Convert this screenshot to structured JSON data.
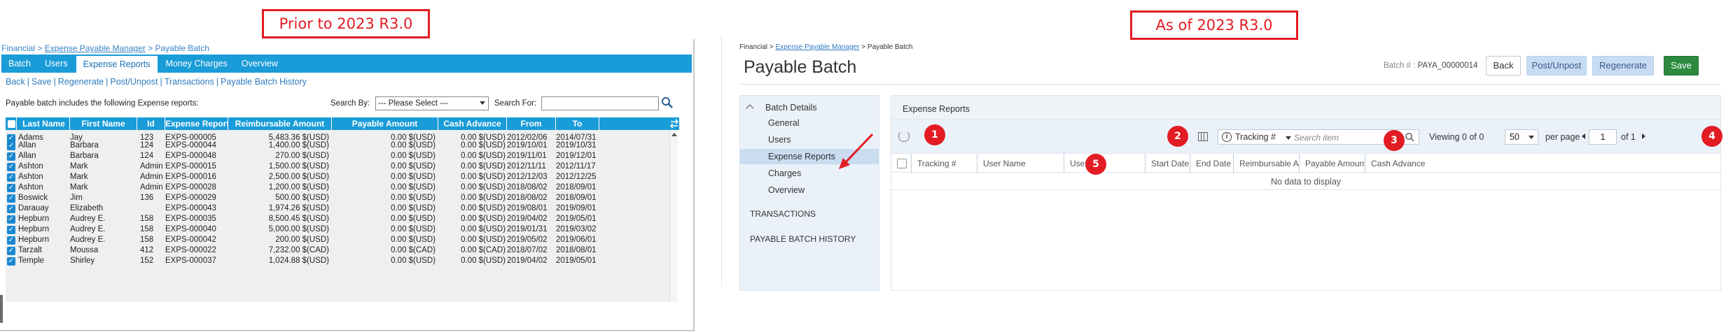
{
  "callouts": {
    "prior": "Prior to 2023 R3.0",
    "asof": "As of 2023 R3.0"
  },
  "old": {
    "breadcrumb": {
      "root": "Financial",
      "sep1": " > ",
      "link": "Expense Payable Manager",
      "sep2": " > ",
      "current": "Payable Batch"
    },
    "tabs": [
      "Batch",
      "Users",
      "Expense Reports",
      "Money Charges",
      "Overview"
    ],
    "links": [
      "Back",
      "Save",
      "Regenerate",
      "Post/Unpost",
      "Transactions",
      "Payable Batch History"
    ],
    "description": "Payable batch includes the following Expense reports:",
    "search_by_label": "Search By:",
    "search_by_value": "--- Please Select ---",
    "search_for_label": "Search For:",
    "search_for_value": "",
    "columns": [
      "Last Name",
      "First Name",
      "Id",
      "Expense Report",
      "Reimbursable Amount",
      "Payable Amount",
      "Cash Advance",
      "From",
      "To"
    ],
    "rows": [
      [
        "Adams",
        "Jay",
        "123",
        "EXPS-000005",
        "5,483.36 $(USD)",
        "0.00 $(USD)",
        "0.00 $(USD)",
        "2012/02/06",
        "2014/07/31"
      ],
      [
        "Allan",
        "Barbara",
        "124",
        "EXPS-000044",
        "1,400.00 $(USD)",
        "0.00 $(USD)",
        "0.00 $(USD)",
        "2019/10/01",
        "2019/10/31"
      ],
      [
        "Allan",
        "Barbara",
        "124",
        "EXPS-000048",
        "270.00 $(USD)",
        "0.00 $(USD)",
        "0.00 $(USD)",
        "2019/11/01",
        "2019/12/01"
      ],
      [
        "Ashton",
        "Mark",
        "Admin",
        "EXPS-000015",
        "1,500.00 $(USD)",
        "0.00 $(USD)",
        "0.00 $(USD)",
        "2012/11/11",
        "2012/11/17"
      ],
      [
        "Ashton",
        "Mark",
        "Admin",
        "EXPS-000016",
        "2,500.00 $(USD)",
        "0.00 $(USD)",
        "0.00 $(USD)",
        "2012/12/03",
        "2012/12/25"
      ],
      [
        "Ashton",
        "Mark",
        "Admin",
        "EXPS-000028",
        "1,200.00 $(USD)",
        "0.00 $(USD)",
        "0.00 $(USD)",
        "2018/08/02",
        "2018/09/01"
      ],
      [
        "Boswick",
        "Jim",
        "136",
        "EXPS-000029",
        "500.00 $(USD)",
        "0.00 $(USD)",
        "0.00 $(USD)",
        "2018/08/02",
        "2018/09/01"
      ],
      [
        "Darauay",
        "Elizabeth",
        "",
        "EXPS-000043",
        "1,974.26 $(USD)",
        "0.00 $(USD)",
        "0.00 $(USD)",
        "2019/08/01",
        "2019/09/01"
      ],
      [
        "Hepburn",
        "Audrey E.",
        "158",
        "EXPS-000035",
        "8,500.45 $(USD)",
        "0.00 $(USD)",
        "0.00 $(USD)",
        "2019/04/02",
        "2019/05/01"
      ],
      [
        "Hepburn",
        "Audrey E.",
        "158",
        "EXPS-000040",
        "5,000.00 $(USD)",
        "0.00 $(USD)",
        "0.00 $(USD)",
        "2019/01/31",
        "2019/03/02"
      ],
      [
        "Hepburn",
        "Audrey E.",
        "158",
        "EXPS-000042",
        "200.00 $(USD)",
        "0.00 $(USD)",
        "0.00 $(USD)",
        "2019/05/02",
        "2019/06/01"
      ],
      [
        "Tarzalt",
        "Moussa",
        "412",
        "EXPS-000022",
        "7,232.00 $(CAD)",
        "0.00 $(CAD)",
        "0.00 $(CAD)",
        "2018/07/02",
        "2018/08/01"
      ],
      [
        "Temple",
        "Shirley",
        "152",
        "EXPS-000037",
        "1,024.88 $(USD)",
        "0.00 $(USD)",
        "0.00 $(USD)",
        "2019/04/02",
        "2019/05/01"
      ]
    ]
  },
  "new": {
    "breadcrumb": {
      "root": "Financial",
      "sep1": " > ",
      "link": "Expense Payable Manager",
      "sep2": " > ",
      "current": "Payable Batch"
    },
    "title": "Payable Batch",
    "batch_label": "Batch # :",
    "batch_number": "PAYA_00000014",
    "buttons": {
      "back": "Back",
      "post": "Post/Unpost",
      "regenerate": "Regenerate",
      "save": "Save"
    },
    "sidebar": {
      "header": "Batch Details",
      "items": [
        "General",
        "Users",
        "Expense Reports",
        "Charges",
        "Overview"
      ],
      "sections": [
        "TRANSACTIONS",
        "PAYABLE BATCH HISTORY"
      ]
    },
    "panel_title": "Expense Reports",
    "search": {
      "field": "Tracking #",
      "placeholder": "Search item"
    },
    "viewing_label": "Viewing",
    "viewing_count": "0 of 0",
    "per_page_value": "50",
    "per_page_label": "per page",
    "page_value": "1",
    "page_of": "of 1",
    "columns": [
      "Tracking #",
      "User Name",
      "User Id",
      "Start Date",
      "End Date",
      "Reimbursable Amount",
      "Payable Amount",
      "Cash Advance"
    ],
    "no_data": "No data to display",
    "badges": [
      "1",
      "2",
      "3",
      "4",
      "5"
    ]
  },
  "colors": {
    "old_header": "#1a9cd8",
    "callout_red": "#e31b23",
    "save_green": "#2b8a3e",
    "sidebar_active": "#c9dcf0"
  }
}
